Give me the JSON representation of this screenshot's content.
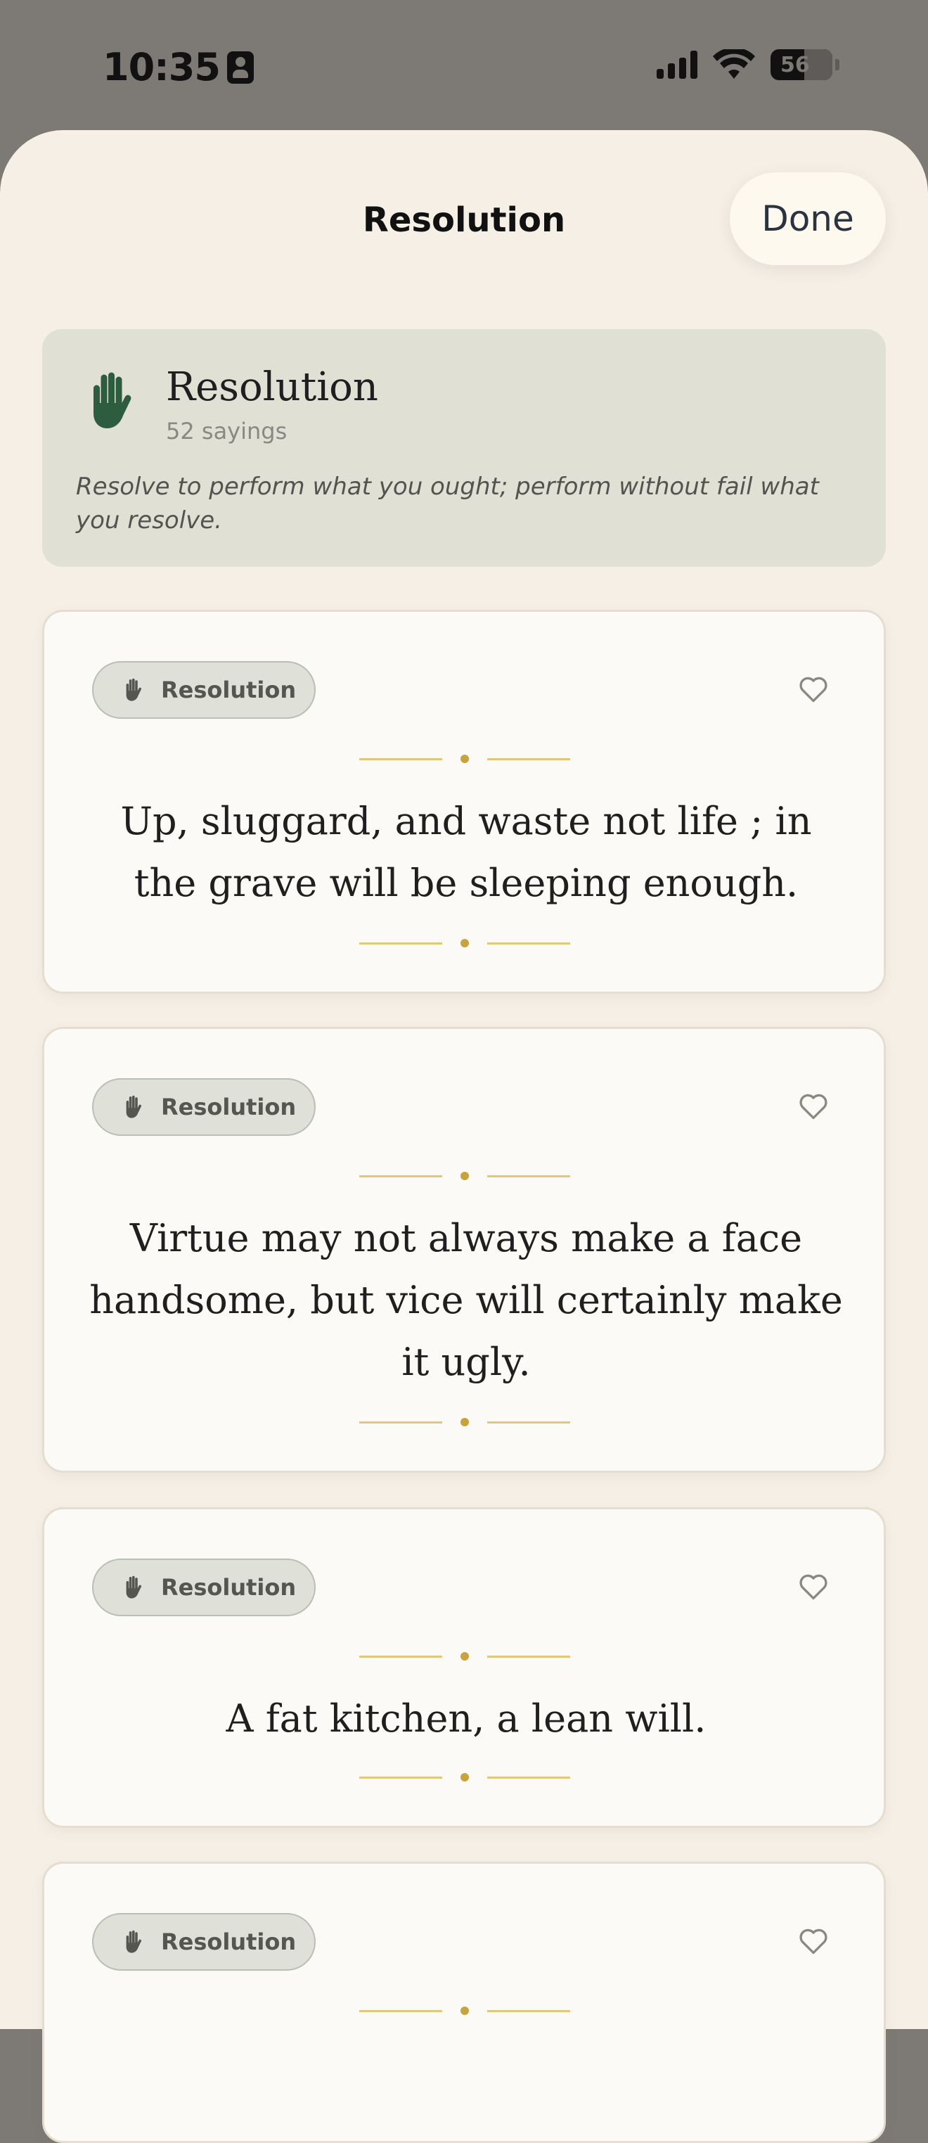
{
  "status": {
    "time": "10:35",
    "battery": "56"
  },
  "sheet": {
    "title": "Resolution",
    "done_label": "Done"
  },
  "category": {
    "name": "Resolution",
    "count": "52 sayings",
    "description": "Resolve to perform what you ought; perform without fail what you resolve.",
    "icon": "hand-icon",
    "accent_color": "#2e5c3e"
  },
  "sayings": [
    {
      "tag": "Resolution",
      "text": "Up, sluggard, and waste not life ; in the grave will be sleeping enough."
    },
    {
      "tag": "Resolution",
      "text": "Virtue may not always make a face handsome, but vice will certainly make it ugly."
    },
    {
      "tag": "Resolution",
      "text": "A fat kitchen, a lean will."
    },
    {
      "tag": "Resolution",
      "text": ""
    }
  ]
}
